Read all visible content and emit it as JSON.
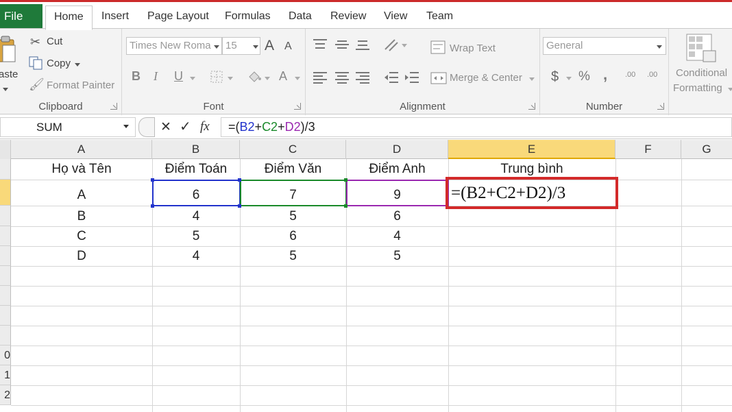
{
  "ribbon": {
    "tabs": {
      "file": "File",
      "home": "Home",
      "insert": "Insert",
      "page_layout": "Page Layout",
      "formulas": "Formulas",
      "data": "Data",
      "review": "Review",
      "view": "View",
      "team": "Team"
    },
    "clipboard": {
      "paste": "aste",
      "cut": "Cut",
      "copy": "Copy",
      "format_painter": "Format Painter",
      "label": "Clipboard"
    },
    "font": {
      "family": "Times New Roma",
      "size": "15",
      "grow": "A",
      "shrink": "A",
      "bold": "B",
      "italic": "I",
      "underline": "U",
      "font_color": "A",
      "label": "Font"
    },
    "alignment": {
      "wrap_text": "Wrap Text",
      "merge_center": "Merge & Center",
      "label": "Alignment"
    },
    "number": {
      "format": "General",
      "currency": "$",
      "percent": "%",
      "comma": ",",
      "inc_decimal": ".00",
      "dec_decimal": ".00",
      "label": "Number"
    },
    "styles": {
      "conditional_line1": "Conditional",
      "conditional_line2": "Formatting"
    }
  },
  "formula_bar": {
    "name_box": "SUM",
    "cancel": "✕",
    "enter": "✓",
    "fx": "fx",
    "formula": {
      "p1": "=(",
      "b": "B2",
      "plus1": "+",
      "c": "C2",
      "plus2": "+",
      "d": "D2",
      "p2": ")/3"
    }
  },
  "sheet": {
    "columns": [
      "A",
      "B",
      "C",
      "D",
      "E",
      "F",
      "G"
    ],
    "row_numbers": [
      "",
      "",
      "",
      "",
      "",
      "",
      "",
      "",
      "",
      "",
      "0",
      "1",
      "2"
    ],
    "headers": [
      "Họ và Tên",
      "Điểm Toán",
      "Điểm Văn",
      "Điểm Anh",
      "Trung bình"
    ],
    "rows": [
      [
        "A",
        "6",
        "7",
        "9"
      ],
      [
        "B",
        "4",
        "5",
        "6"
      ],
      [
        "C",
        "5",
        "6",
        "4"
      ],
      [
        "D",
        "4",
        "5",
        "5"
      ]
    ],
    "active_formula": "=(B2+C2+D2)/3"
  },
  "colors": {
    "file_tab": "#1f7a3a",
    "ref_b": "#2233cc",
    "ref_c": "#1a8a2a",
    "ref_d": "#9a28b0",
    "highlight": "#d32a2a",
    "selected_header": "#f9d97a"
  }
}
